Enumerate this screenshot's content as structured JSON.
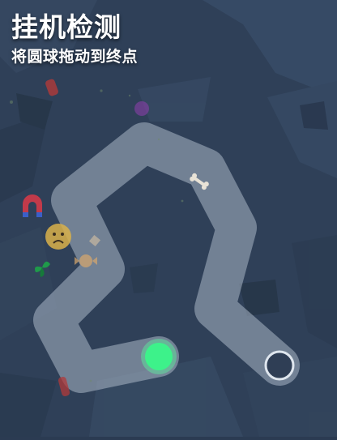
{
  "header": {
    "title": "挂机检测",
    "subtitle": "将圆球拖动到终点"
  },
  "colors": {
    "background": "#2f4058",
    "track": "#a9b7c6",
    "ball": "#3df28a",
    "ball_ring": "#5ef5a0",
    "goal": "#2f3e55",
    "text": "#ffffff"
  },
  "decorations": [
    "magnet-icon",
    "sad-face-icon",
    "leaf-icon",
    "bone-icon",
    "candy-icon",
    "orb-icon"
  ]
}
